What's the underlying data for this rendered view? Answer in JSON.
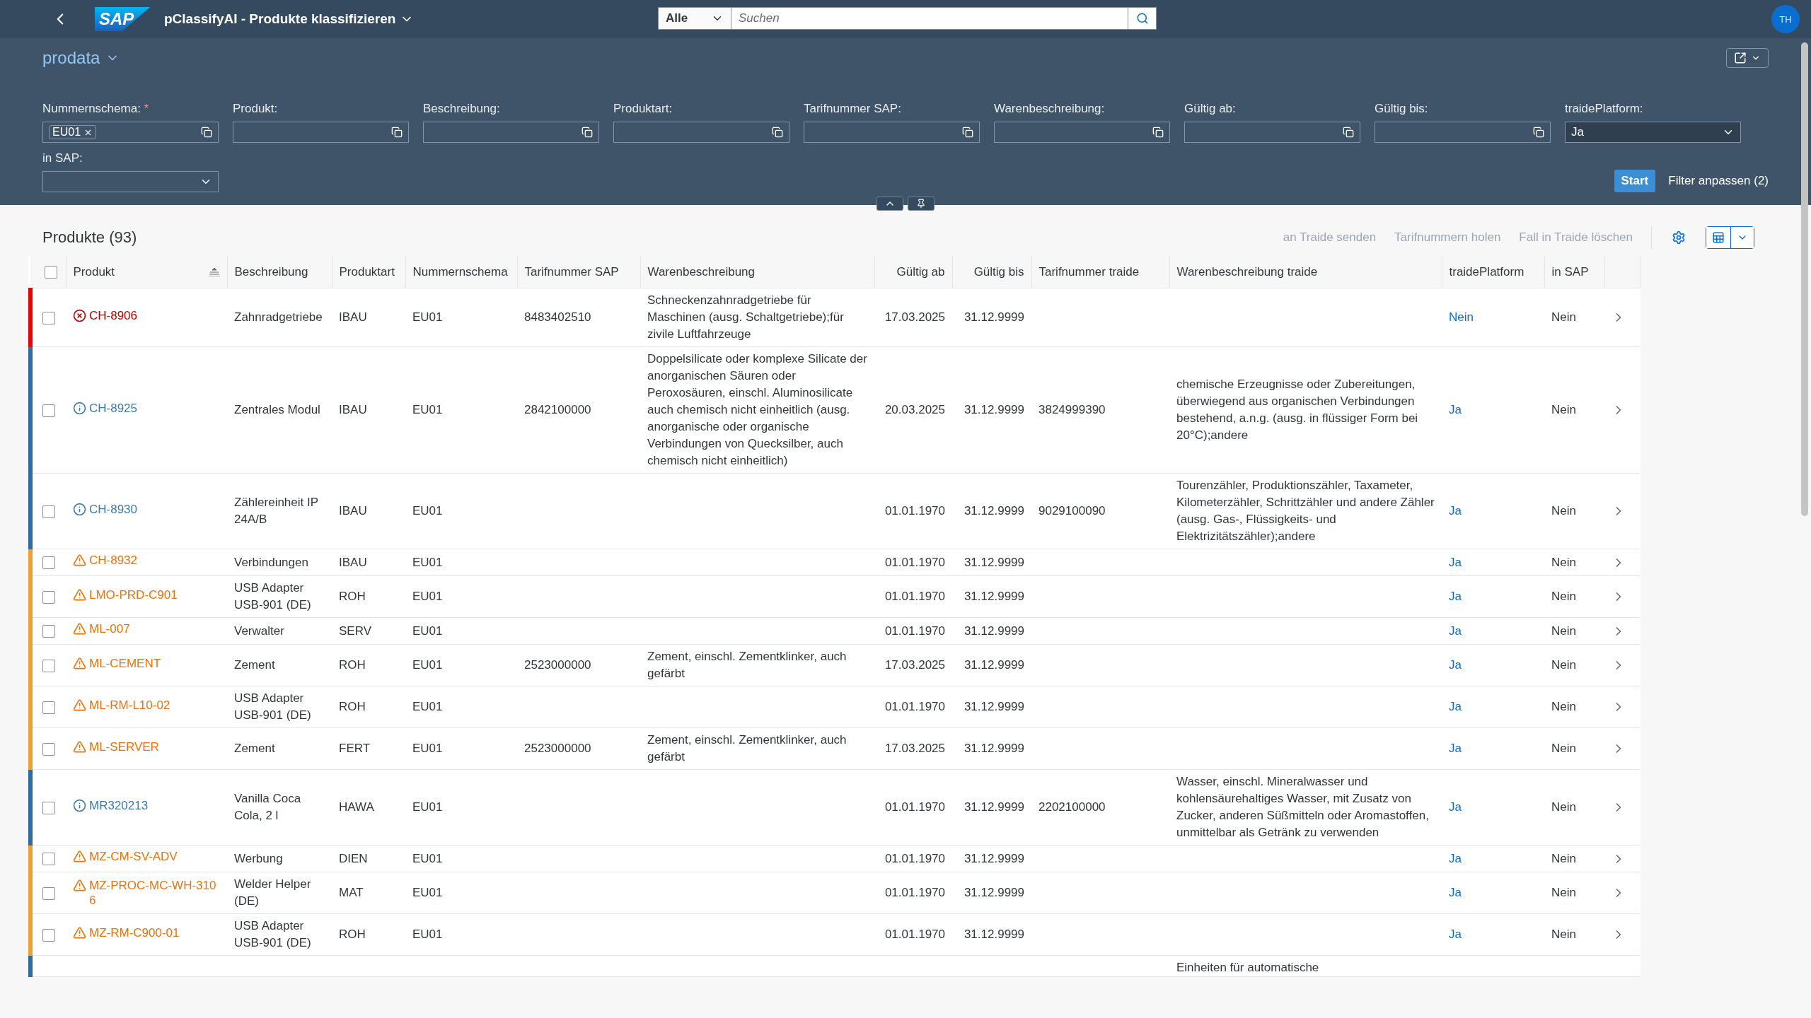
{
  "shell": {
    "logo": "SAP",
    "title": "pClassifyAI - Produkte klassifizieren",
    "search_scope": "Alle",
    "search": {
      "placeholder": "Suchen"
    },
    "avatar": "TH"
  },
  "header": {
    "variant": "prodata",
    "filters": [
      {
        "label": "Nummernschema:",
        "required_mark": "*",
        "kind": "tokens",
        "tokens": [
          "EU01"
        ]
      },
      {
        "label": "Produkt:",
        "kind": "input"
      },
      {
        "label": "Beschreibung:",
        "kind": "input"
      },
      {
        "label": "Produktart:",
        "kind": "input"
      },
      {
        "label": "Tarifnummer SAP:",
        "kind": "input"
      },
      {
        "label": "Warenbeschreibung:",
        "kind": "input"
      },
      {
        "label": "Gültig ab:",
        "kind": "input"
      },
      {
        "label": "Gültig bis:",
        "kind": "input"
      },
      {
        "label": "traidePlatform:",
        "kind": "select",
        "value": "Ja"
      },
      {
        "label": "in SAP:",
        "kind": "select"
      }
    ],
    "buttons": [
      "Start",
      "Filter anpassen (2)"
    ]
  },
  "table": {
    "title": "Produkte (93)",
    "actions": [
      {
        "label": "an Traide senden",
        "disabled": true
      },
      {
        "label": "Tarifnummern holen",
        "disabled": true
      },
      {
        "label": "Fall in Traide löschen",
        "disabled": true
      }
    ],
    "select_all": {
      "checked": false
    },
    "columns": [
      "Produkt",
      "Beschreibung",
      "Produktart",
      "Nummernschema",
      "Tarifnummer SAP",
      "Warenbeschreibung",
      "Gültig ab",
      "Gültig bis",
      "Tarifnummer traide",
      "Warenbeschreibung traide",
      "traidePlatform",
      "in SAP"
    ],
    "rows": [
      {
        "kind": "error",
        "selected": false,
        "product": "CH-8906",
        "description": "Zahnradgetriebe",
        "type": "IBAU",
        "schema": "EU01",
        "tariff_sap": "8483402510",
        "goods_description": "Schneckenzahnradgetriebe für Maschinen (ausg. Schaltgetriebe);für zivile Luftfahrzeuge",
        "valid_from": "17.03.2025",
        "valid_to": "31.12.9999",
        "traide_platform": "Nein",
        "in_sap": "Nein"
      },
      {
        "kind": "info",
        "selected": false,
        "product": "CH-8925",
        "description": "Zentrales Modul",
        "type": "IBAU",
        "schema": "EU01",
        "tariff_sap": "2842100000",
        "goods_description": "Doppelsilicate oder komplexe Silicate der anorganischen Säuren oder Peroxosäuren, einschl. Aluminosilicate auch chemisch nicht einheitlich (ausg. anorganische oder organische Verbindungen von Quecksilber, auch chemisch nicht einheitlich)",
        "valid_from": "20.03.2025",
        "valid_to": "31.12.9999",
        "tariff_traide": "3824999390",
        "goods_description_traide": "chemische Erzeugnisse oder Zubereitungen, überwiegend aus organischen Verbindungen bestehend, a.n.g. (ausg. in flüssiger Form bei 20°C);andere",
        "traide_platform": "Ja",
        "in_sap": "Nein"
      },
      {
        "kind": "info",
        "selected": false,
        "product": "CH-8930",
        "description": "Zählereinheit IP 24A/B",
        "type": "IBAU",
        "schema": "EU01",
        "valid_from": "01.01.1970",
        "valid_to": "31.12.9999",
        "tariff_traide": "9029100090",
        "goods_description_traide": "Tourenzähler, Produktionszähler, Taxameter, Kilometerzähler, Schrittzähler und andere Zähler (ausg. Gas-, Flüssigkeits- und Elektrizitätszähler);andere",
        "traide_platform": "Ja",
        "in_sap": "Nein"
      },
      {
        "kind": "warning",
        "selected": false,
        "product": "CH-8932",
        "description": "Verbindungen",
        "type": "IBAU",
        "schema": "EU01",
        "valid_from": "01.01.1970",
        "valid_to": "31.12.9999",
        "traide_platform": "Ja",
        "in_sap": "Nein"
      },
      {
        "kind": "warning",
        "selected": false,
        "product": "LMO-PRD-C901",
        "description": "USB Adapter USB-901 (DE)",
        "type": "ROH",
        "schema": "EU01",
        "valid_from": "01.01.1970",
        "valid_to": "31.12.9999",
        "traide_platform": "Ja",
        "in_sap": "Nein"
      },
      {
        "kind": "warning",
        "selected": false,
        "product": "ML-007",
        "description": "Verwalter",
        "type": "SERV",
        "schema": "EU01",
        "valid_from": "01.01.1970",
        "valid_to": "31.12.9999",
        "traide_platform": "Ja",
        "in_sap": "Nein"
      },
      {
        "kind": "warning",
        "selected": false,
        "product": "ML-CEMENT",
        "description": "Zement",
        "type": "ROH",
        "schema": "EU01",
        "tariff_sap": "2523000000",
        "goods_description": "Zement, einschl. Zementklinker, auch gefärbt",
        "valid_from": "17.03.2025",
        "valid_to": "31.12.9999",
        "traide_platform": "Ja",
        "in_sap": "Nein"
      },
      {
        "kind": "warning",
        "selected": false,
        "product": "ML-RM-L10-02",
        "description": "USB Adapter USB-901 (DE)",
        "type": "ROH",
        "schema": "EU01",
        "valid_from": "01.01.1970",
        "valid_to": "31.12.9999",
        "traide_platform": "Ja",
        "in_sap": "Nein"
      },
      {
        "kind": "warning",
        "selected": false,
        "product": "ML-SERVER",
        "description": "Zement",
        "type": "FERT",
        "schema": "EU01",
        "tariff_sap": "2523000000",
        "goods_description": "Zement, einschl. Zementklinker, auch gefärbt",
        "valid_from": "17.03.2025",
        "valid_to": "31.12.9999",
        "traide_platform": "Ja",
        "in_sap": "Nein"
      },
      {
        "kind": "info",
        "selected": false,
        "product": "MR320213",
        "description": "Vanilla Coca Cola, 2 l",
        "type": "HAWA",
        "schema": "EU01",
        "valid_from": "01.01.1970",
        "valid_to": "31.12.9999",
        "tariff_traide": "2202100000",
        "goods_description_traide": "Wasser, einschl. Mineralwasser und kohlensäurehaltiges Wasser, mit Zusatz von Zucker, anderen Süßmitteln oder Aromastoffen, unmittelbar als Getränk zu verwenden",
        "traide_platform": "Ja",
        "in_sap": "Nein"
      },
      {
        "kind": "warning",
        "selected": false,
        "product": "MZ-CM-SV-ADV",
        "description": "Werbung",
        "type": "DIEN",
        "schema": "EU01",
        "valid_from": "01.01.1970",
        "valid_to": "31.12.9999",
        "traide_platform": "Ja",
        "in_sap": "Nein"
      },
      {
        "kind": "warning",
        "selected": false,
        "product": "MZ-PROC-MC-WH-3106",
        "description": "Welder Helper (DE)",
        "type": "MAT",
        "schema": "EU01",
        "valid_from": "01.01.1970",
        "valid_to": "31.12.9999",
        "traide_platform": "Ja",
        "in_sap": "Nein"
      },
      {
        "kind": "warning",
        "selected": false,
        "product": "MZ-RM-C900-01",
        "description": "USB Adapter USB-901 (DE)",
        "type": "ROH",
        "schema": "EU01",
        "valid_from": "01.01.1970",
        "valid_to": "31.12.9999",
        "traide_platform": "Ja",
        "in_sap": "Nein"
      },
      {
        "kind": "info",
        "goods_description_traide": "Einheiten für automatische"
      }
    ]
  }
}
